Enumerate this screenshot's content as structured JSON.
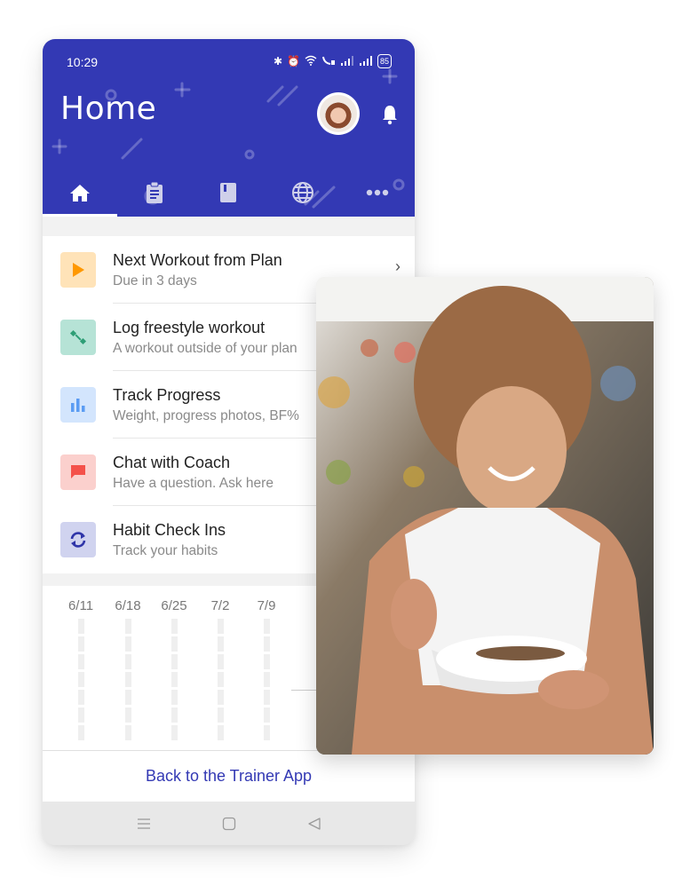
{
  "status_bar": {
    "time": "10:29",
    "icons": [
      "bluetooth-icon",
      "alarm-icon",
      "wifi-icon",
      "wifi-call-icon",
      "signal-icon",
      "signal-icon"
    ],
    "battery": "85"
  },
  "header": {
    "title": "Home",
    "bg_color": "#3339b4"
  },
  "tabs": [
    {
      "name": "home",
      "icon": "home-icon",
      "active": true
    },
    {
      "name": "clipboard",
      "icon": "clipboard-icon",
      "active": false
    },
    {
      "name": "book",
      "icon": "book-icon",
      "active": false
    },
    {
      "name": "globe",
      "icon": "globe-icon",
      "active": false
    },
    {
      "name": "more",
      "icon": "more-icon",
      "active": false
    }
  ],
  "menu": [
    {
      "title": "Next Workout from Plan",
      "subtitle": "Due in 3 days",
      "icon": "play-icon",
      "icon_bg": "#ffe3b8",
      "icon_color": "#ff9800",
      "has_chevron": true
    },
    {
      "title": "Log freestyle workout",
      "subtitle": "A workout outside of your plan",
      "icon": "dumbbell-icon",
      "icon_bg": "#b6e3d6",
      "icon_color": "#2e9e76"
    },
    {
      "title": "Track Progress",
      "subtitle": "Weight, progress photos, BF%",
      "icon": "bar-chart-icon",
      "icon_bg": "#d3e5fd",
      "icon_color": "#5b9cf3"
    },
    {
      "title": "Chat with Coach",
      "subtitle": "Have a question. Ask here",
      "icon": "chat-icon",
      "icon_bg": "#fbd0cd",
      "icon_color": "#f4514a"
    },
    {
      "title": "Habit Check Ins",
      "subtitle": "Track your habits",
      "icon": "sync-icon",
      "icon_bg": "#d0d3ef",
      "icon_color": "#2f35a8"
    }
  ],
  "chart_dates": [
    "6/11",
    "6/18",
    "6/25",
    "7/2",
    "7/9"
  ],
  "footer": {
    "back_label": "Back to the Trainer App"
  },
  "navbar": [
    "menu-icon",
    "home-square-icon",
    "back-triangle-icon"
  ],
  "photo": {
    "description": "woman eating from a bowl"
  }
}
